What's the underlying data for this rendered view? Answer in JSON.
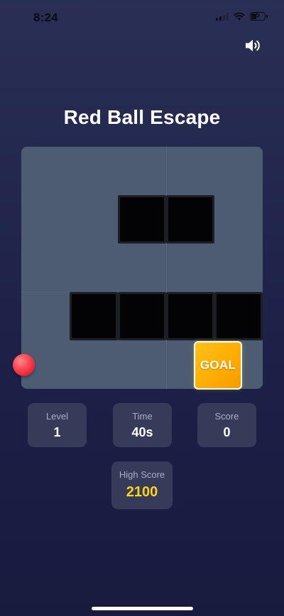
{
  "status_bar": {
    "time": "8:24",
    "battery": "5"
  },
  "icons": {
    "sound": "speaker-wave-icon",
    "signal": "cellular-signal-icon",
    "wifi": "wifi-icon",
    "battery": "battery-icon"
  },
  "game": {
    "title": "Red Ball Escape",
    "goal_label": "GOAL",
    "colors": {
      "board": "#4e5c72",
      "wall": "#030305",
      "goal": "#ffb300",
      "ball": "#ff4a55",
      "high_score": "#ffd21f"
    }
  },
  "stats": {
    "level": {
      "label": "Level",
      "value": "1"
    },
    "time": {
      "label": "Time",
      "value": "40s"
    },
    "score": {
      "label": "Score",
      "value": "0"
    },
    "high_score": {
      "label": "High Score",
      "value": "2100"
    }
  }
}
